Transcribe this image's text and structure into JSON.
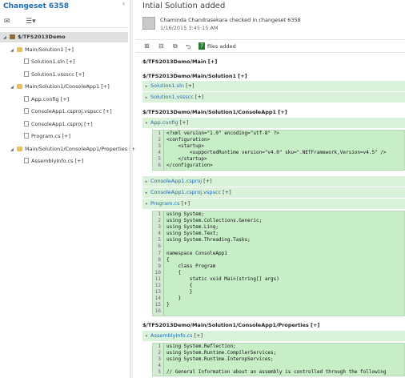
{
  "left": {
    "title": "Changeset 6358",
    "collapse_glyph": "‹",
    "toolbar": [
      {
        "name": "mail-icon",
        "glyph": "✉"
      },
      {
        "name": "view-options-icon",
        "glyph": "☰▾"
      }
    ],
    "tree": [
      {
        "label": "$/TFS2013Demo",
        "kind": "root",
        "indent": 0,
        "selected": true
      },
      {
        "label": "Main/Solution1 [+]",
        "kind": "folder",
        "indent": 1
      },
      {
        "label": "Solution1.sln [+]",
        "kind": "file",
        "indent": 2
      },
      {
        "label": "Solution1.vssscc [+]",
        "kind": "file",
        "indent": 2
      },
      {
        "label": "Main/Solution1/ConsoleApp1 [+]",
        "kind": "folder",
        "indent": 1
      },
      {
        "label": "App.config [+]",
        "kind": "file",
        "indent": 2
      },
      {
        "label": "ConsoleApp1.csproj.vspscc [+]",
        "kind": "file",
        "indent": 2
      },
      {
        "label": "ConsoleApp1.csproj [+]",
        "kind": "file",
        "indent": 2
      },
      {
        "label": "Program.cs [+]",
        "kind": "file",
        "indent": 2
      },
      {
        "label": "Main/Solution1/ConsoleApp1/Properties [+",
        "kind": "folder",
        "indent": 1
      },
      {
        "label": "AssemblyInfo.cs [+]",
        "kind": "file",
        "indent": 2
      }
    ]
  },
  "right": {
    "comment": "Intial Solution added",
    "checkin": "Chaminda Chandrasekara checked in changeset 6358",
    "date": "1/16/2015 3:45:15 AM",
    "toolbar": {
      "files_count": "7",
      "files_label": "files added"
    },
    "sections": [
      {
        "path": "$/TFS2013Demo/Main [+]"
      },
      {
        "path": "$/TFS2013Demo/Main/Solution1 [+]",
        "files": [
          {
            "name": "Solution1.sln",
            "suffix": " [+]"
          },
          {
            "name": "Solution1.vssscc",
            "suffix": " [+]"
          }
        ]
      },
      {
        "path": "$/TFS2013Demo/Main/Solution1/ConsoleApp1 [+]",
        "files": [
          {
            "name": "App.config",
            "suffix": " [+]",
            "expanded": true
          }
        ]
      }
    ],
    "app_config_code": [
      "<?xml version=\"1.0\" encoding=\"utf-8\" ?>",
      "<configuration>",
      "    <startup>",
      "        <supportedRuntime version=\"v4.0\" sku=\".NETFramework,Version=v4.5\" />",
      "    </startup>",
      "</configuration>"
    ],
    "mid_files": [
      {
        "name": "ConsoleApp1.csproj",
        "suffix": " [+]"
      },
      {
        "name": "ConsoleApp1.csproj.vspscc",
        "suffix": " [+]"
      },
      {
        "name": "Program.cs",
        "suffix": " [+]"
      }
    ],
    "program_code": [
      "using System;",
      "using System.Collections.Generic;",
      "using System.Linq;",
      "using System.Text;",
      "using System.Threading.Tasks;",
      "",
      "namespace ConsoleApp1",
      "{",
      "    class Program",
      "    {",
      "        static void Main(string[] args)",
      "        {",
      "        }",
      "    }",
      "}",
      ""
    ],
    "properties_path": "$/TFS2013Demo/Main/Solution1/ConsoleApp1/Properties [+]",
    "assembly_file": {
      "name": "AssemblyInfo.cs",
      "suffix": " [+]"
    },
    "assembly_code": [
      "using System.Reflection;",
      "using System.Runtime.CompilerServices;",
      "using System.Runtime.InteropServices;",
      "",
      "// General Information about an assembly is controlled through the following"
    ]
  }
}
